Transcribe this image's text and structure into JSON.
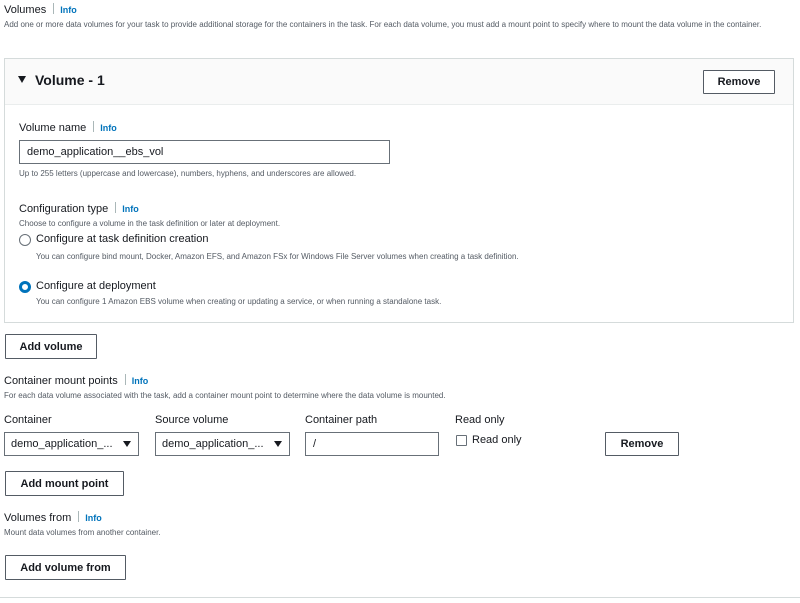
{
  "volumes": {
    "title": "Volumes",
    "info": "Info",
    "description": "Add one or more data volumes for your task to provide additional storage for the containers in the task. For each data volume, you must add a mount point to specify where to mount the data volume in the container."
  },
  "volume_panel": {
    "title": "Volume - 1",
    "remove_label": "Remove",
    "volume_name": {
      "label": "Volume name",
      "info": "Info",
      "value": "demo_application__ebs_vol",
      "hint": "Up to 255 letters (uppercase and lowercase), numbers, hyphens, and underscores are allowed."
    },
    "configuration_type": {
      "label": "Configuration type",
      "info": "Info",
      "description": "Choose to configure a volume in the task definition or later at deployment.",
      "options": [
        {
          "label": "Configure at task definition creation",
          "description": "You can configure bind mount, Docker, Amazon EFS, and Amazon FSx for Windows File Server volumes when creating a task definition.",
          "selected": false
        },
        {
          "label": "Configure at deployment",
          "description": "You can configure 1 Amazon EBS volume when creating or updating a service, or when running a standalone task.",
          "selected": true
        }
      ]
    }
  },
  "add_volume_label": "Add volume",
  "mount_points": {
    "title": "Container mount points",
    "info": "Info",
    "description": "For each data volume associated with the task, add a container mount point to determine where the data volume is mounted.",
    "columns": {
      "container": "Container",
      "source_volume": "Source volume",
      "container_path": "Container path",
      "read_only": "Read only"
    },
    "row": {
      "container": "demo_application_...",
      "source_volume": "demo_application_...",
      "container_path": "/",
      "read_only_label": "Read only",
      "read_only_checked": false,
      "remove_label": "Remove"
    },
    "add_label": "Add mount point"
  },
  "volumes_from": {
    "title": "Volumes from",
    "info": "Info",
    "description": "Mount data volumes from another container.",
    "add_label": "Add volume from"
  },
  "colors": {
    "link": "#0073bb",
    "panel_border": "#d5dbdb",
    "panel_header_bg": "#fafafa"
  }
}
